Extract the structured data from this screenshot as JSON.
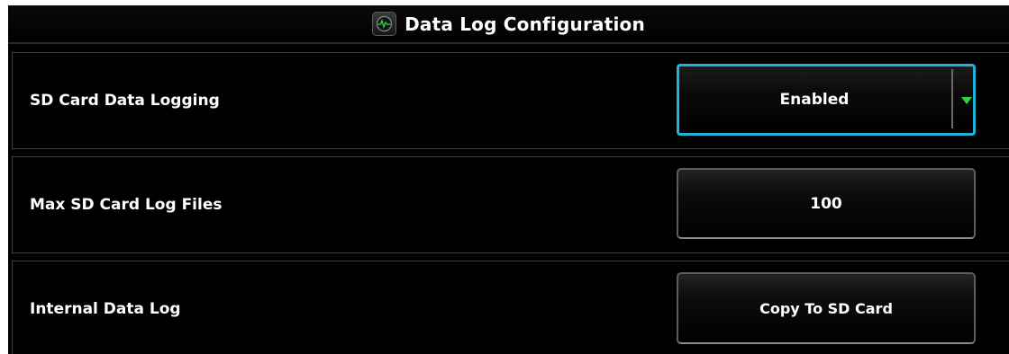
{
  "title_bar": {
    "icon": "data-log-gauge-icon",
    "title": "Data Log Configuration"
  },
  "rows": [
    {
      "label": "SD Card Data Logging",
      "control": "select",
      "value": "Enabled",
      "focused": true,
      "arrow_icon": "dropdown-arrow-icon"
    },
    {
      "label": "Max SD Card Log Files",
      "control": "button",
      "value": "100"
    },
    {
      "label": "Internal Data Log",
      "control": "button",
      "value": "Copy To SD Card"
    }
  ],
  "colors": {
    "background": "#000000",
    "text": "#ffffff",
    "focus_border": "#1fb2d6",
    "dropdown_arrow": "#2fd63a",
    "row_border": "#3d3d3d"
  }
}
